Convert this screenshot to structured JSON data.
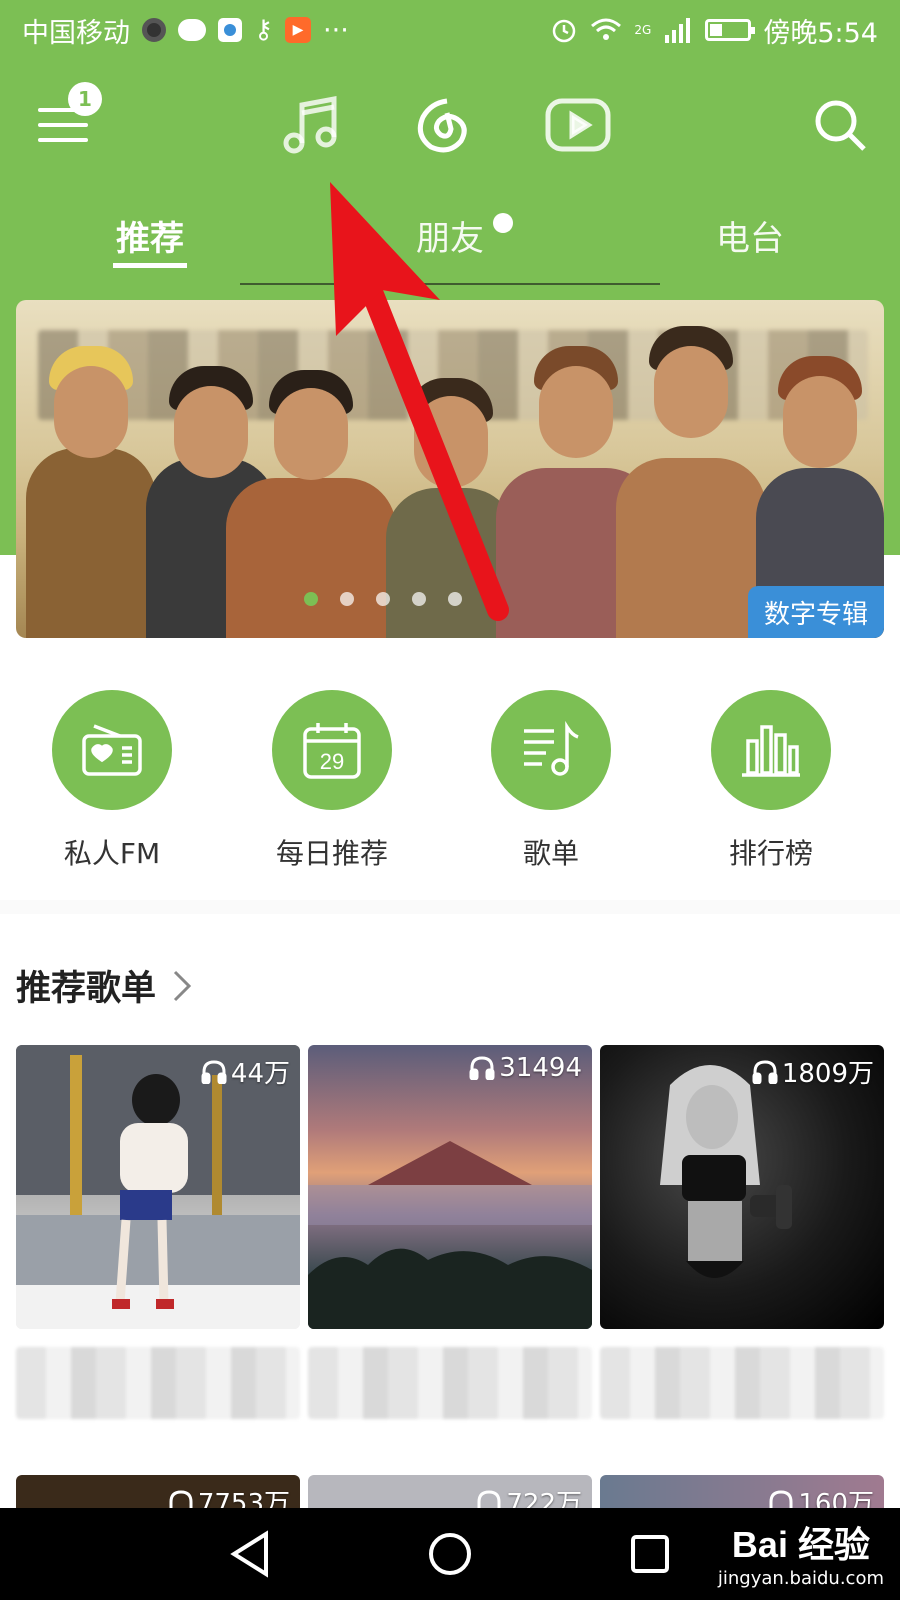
{
  "status_bar": {
    "carrier": "中国移动",
    "network_type": "2G",
    "time": "傍晚5:54",
    "more": "···"
  },
  "top_nav": {
    "menu_badge": "1",
    "icons": [
      "menu-icon",
      "music-note-icon",
      "netease-cloud-music-icon",
      "video-play-icon",
      "search-icon"
    ]
  },
  "tabs": [
    {
      "label": "推荐",
      "active": true
    },
    {
      "label": "朋友",
      "active": false,
      "has_dot": true
    },
    {
      "label": "电台",
      "active": false
    }
  ],
  "banner": {
    "tag": "数字专辑",
    "dot_count": 5,
    "active_dot_index": 0
  },
  "entries": [
    {
      "label": "私人FM",
      "icon": "radio-icon"
    },
    {
      "label": "每日推荐",
      "icon": "calendar-icon",
      "icon_text": "29"
    },
    {
      "label": "歌单",
      "icon": "playlist-icon"
    },
    {
      "label": "排行榜",
      "icon": "chart-bars-icon"
    }
  ],
  "recommended": {
    "title": "推荐歌单",
    "playlists": [
      {
        "play_count": "44万"
      },
      {
        "play_count": "31494"
      },
      {
        "play_count": "1809万"
      }
    ],
    "next_row": [
      {
        "play_count": "7753万"
      },
      {
        "play_count": "722万"
      },
      {
        "play_count": "160万"
      }
    ]
  },
  "watermark": {
    "logo": "Bai 经验",
    "url": "jingyan.baidu.com"
  },
  "colors": {
    "brand_green": "#7cbf54",
    "tag_blue": "#3a8fd8",
    "annotation_red": "#e8141b"
  }
}
